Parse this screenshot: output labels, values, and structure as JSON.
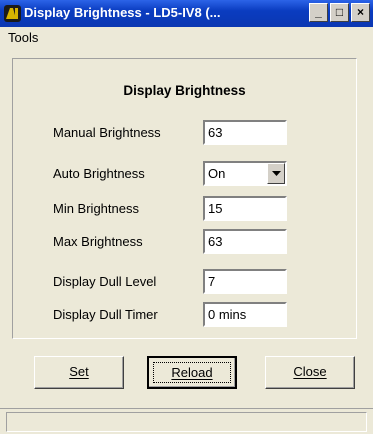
{
  "window": {
    "title": "Display Brightness - LD5-IV8 (...",
    "icon": "app-logo-icon",
    "controls": {
      "minimize": "_",
      "maximize": "□",
      "close": "×"
    }
  },
  "menu": {
    "items": [
      {
        "label": "Tools"
      }
    ]
  },
  "panel": {
    "title": "Display Brightness",
    "fields": {
      "manual_brightness": {
        "label": "Manual Brightness",
        "value": "63"
      },
      "auto_brightness": {
        "label": "Auto Brightness",
        "value": "On"
      },
      "min_brightness": {
        "label": "Min Brightness",
        "value": "15"
      },
      "max_brightness": {
        "label": "Max Brightness",
        "value": "63"
      },
      "display_dull_level": {
        "label": "Display Dull Level",
        "value": "7"
      },
      "display_dull_timer": {
        "label": "Display Dull Timer",
        "value": "0 mins"
      }
    }
  },
  "buttons": {
    "set": "Set",
    "reload": "Reload",
    "close": "Close"
  },
  "status": {
    "text": ""
  },
  "colors": {
    "titlebar": "#0a3cc0",
    "face": "#ece9d8",
    "icon": "#d7b400"
  }
}
